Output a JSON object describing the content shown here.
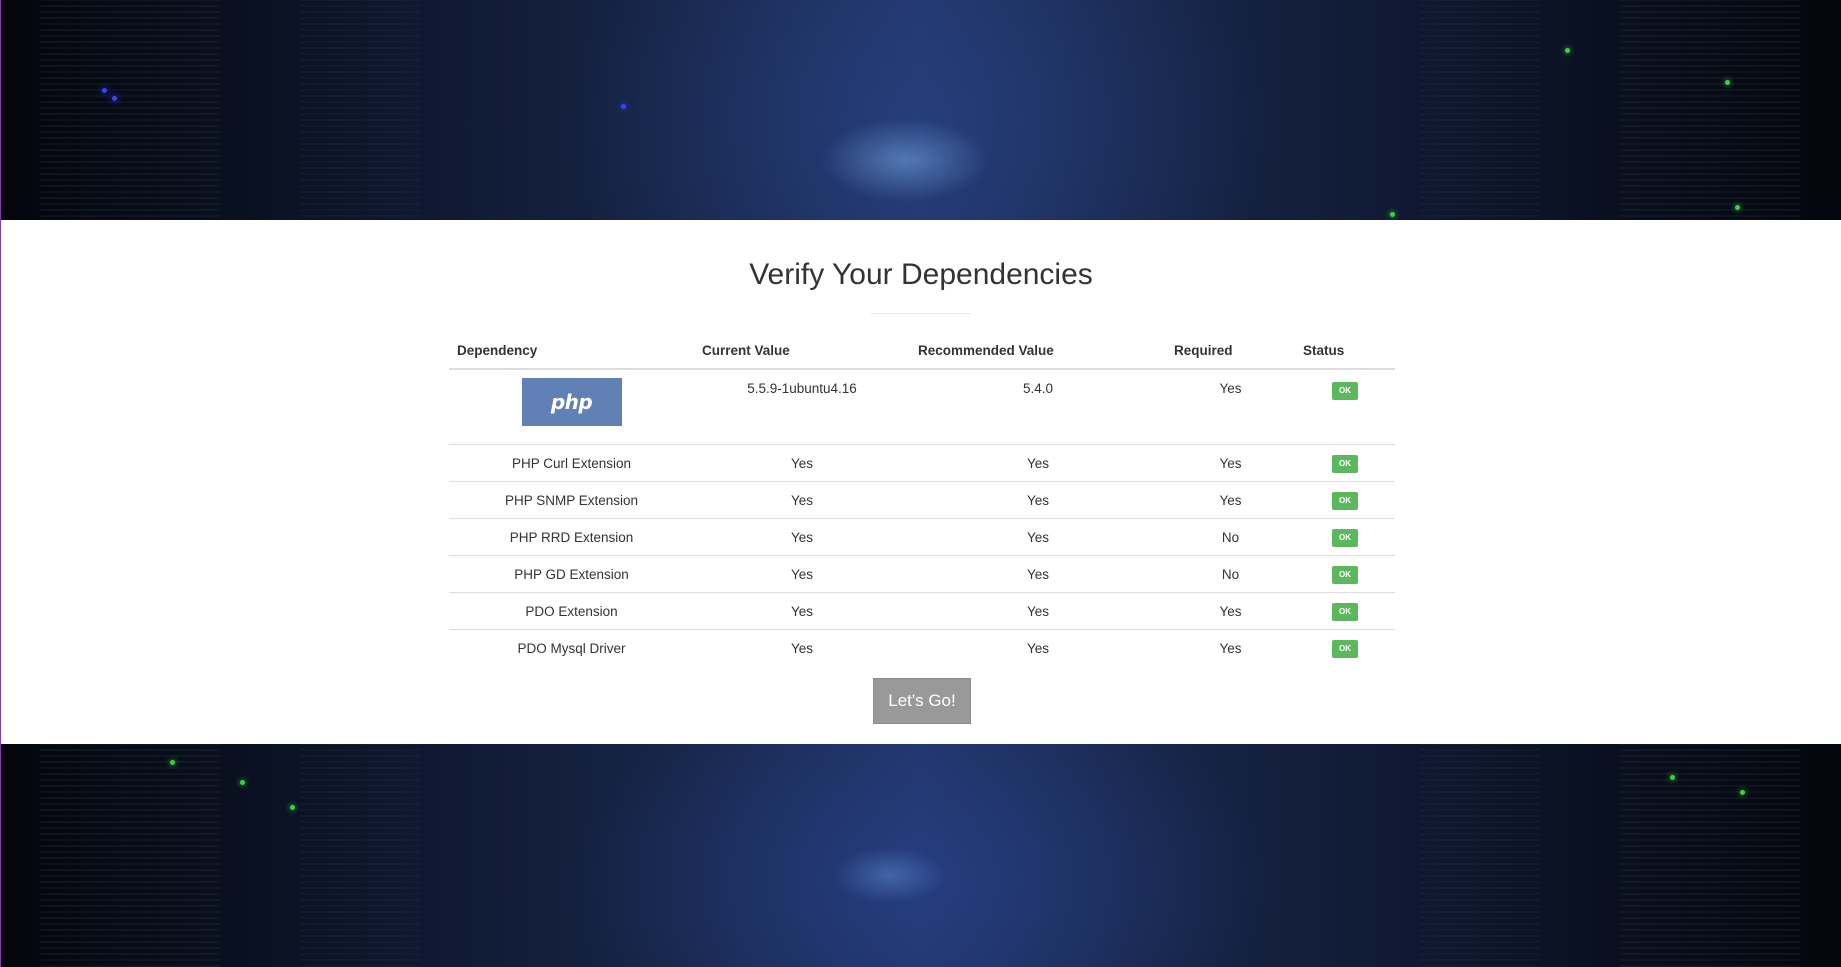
{
  "page": {
    "title": "Verify Your Dependencies",
    "action_button": "Let's Go!"
  },
  "table": {
    "headers": [
      "Dependency",
      "Current Value",
      "Recommended Value",
      "Required",
      "Status"
    ],
    "rows": [
      {
        "dependency": "php",
        "dependency_is_logo": true,
        "current": "5.5.9-1ubuntu4.16",
        "recommended": "5.4.0",
        "required": "Yes",
        "status": "OK"
      },
      {
        "dependency": "PHP Curl Extension",
        "current": "Yes",
        "recommended": "Yes",
        "required": "Yes",
        "status": "OK"
      },
      {
        "dependency": "PHP SNMP Extension",
        "current": "Yes",
        "recommended": "Yes",
        "required": "Yes",
        "status": "OK"
      },
      {
        "dependency": "PHP RRD Extension",
        "current": "Yes",
        "recommended": "Yes",
        "required": "No",
        "status": "OK"
      },
      {
        "dependency": "PHP GD Extension",
        "current": "Yes",
        "recommended": "Yes",
        "required": "No",
        "status": "OK"
      },
      {
        "dependency": "PDO Extension",
        "current": "Yes",
        "recommended": "Yes",
        "required": "Yes",
        "status": "OK"
      },
      {
        "dependency": "PDO Mysql Driver",
        "current": "Yes",
        "recommended": "Yes",
        "required": "Yes",
        "status": "OK"
      }
    ]
  },
  "colors": {
    "ok_badge": "#5cb85c",
    "php_logo_bg": "#6181b6",
    "button_bg": "#999999",
    "background_accent": "#223466"
  }
}
